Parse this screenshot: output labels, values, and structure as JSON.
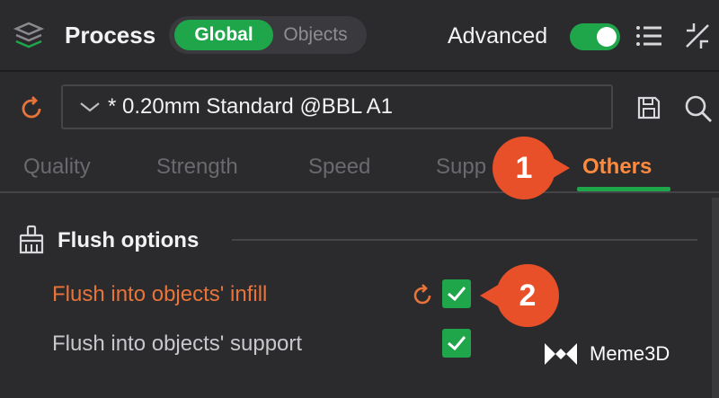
{
  "header": {
    "title": "Process",
    "mode_global": "Global",
    "mode_objects": "Objects",
    "advanced_label": "Advanced",
    "advanced_on": true
  },
  "preset": {
    "value": "* 0.20mm Standard @BBL A1"
  },
  "tabs": [
    {
      "label": "Quality",
      "active": false
    },
    {
      "label": "Strength",
      "active": false
    },
    {
      "label": "Speed",
      "active": false
    },
    {
      "label": "Supp",
      "active": false
    },
    {
      "label": "Others",
      "active": true
    }
  ],
  "callouts": [
    "1",
    "2"
  ],
  "section": {
    "title": "Flush options",
    "options": [
      {
        "label": "Flush into objects' infill",
        "checked": true,
        "modified": true
      },
      {
        "label": "Flush into objects' support",
        "checked": true,
        "modified": false
      }
    ]
  },
  "watermark": "Meme3D",
  "colors": {
    "accent_green": "#1fa64a",
    "active_orange": "#ff8a3d",
    "modified_orange": "#e8743a",
    "callout_red": "#e8502a",
    "background": "#2b2b2e"
  }
}
